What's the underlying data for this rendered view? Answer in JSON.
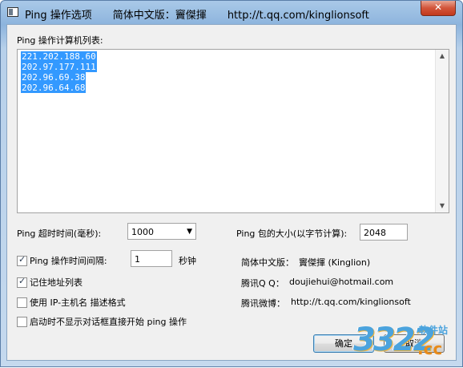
{
  "window": {
    "title": "Ping 操作选项",
    "title_author": "简体中文版：竇傑揮",
    "title_url": "http://t.qq.com/kinglionsoft",
    "close_label": "✕"
  },
  "host_list": {
    "label": "Ping 操作计算机列表:",
    "entries": [
      "221.202.188.60",
      "202.97.177.111",
      "202.96.69.38",
      "202.96.64.68"
    ]
  },
  "timeout": {
    "label": "Ping 超时时间(毫秒):",
    "value": "1000"
  },
  "packet_size": {
    "label": "Ping 包的大小(以字节计算):",
    "value": "2048"
  },
  "interval": {
    "checkbox_label": "Ping 操作时间间隔:",
    "checked": true,
    "value": "1",
    "unit": "秒钟"
  },
  "remember_list": {
    "label": "记住地址列表",
    "checked": true
  },
  "ip_host_format": {
    "label": "使用 IP-主机名 描述格式",
    "checked": false
  },
  "start_without_dialog": {
    "label": "启动时不显示对话框直接开始 ping 操作",
    "checked": false
  },
  "info": {
    "translator_label": "简体中文版：",
    "translator_value": "竇傑揮 (Kinglion)",
    "qq_label": "腾讯Q Q：",
    "qq_value": "doujiehui@hotmail.com",
    "weibo_label": "腾讯微博：",
    "weibo_value": "http://t.qq.com/kinglionsoft"
  },
  "buttons": {
    "ok": "确定",
    "cancel": "取消"
  },
  "watermark": {
    "number": "3322",
    "domain": ".cc",
    "site": "软件站"
  },
  "colors": {
    "selection": "#3399ff",
    "dialog_bg": "#f0f0f0",
    "close_button": "#c2381c"
  }
}
